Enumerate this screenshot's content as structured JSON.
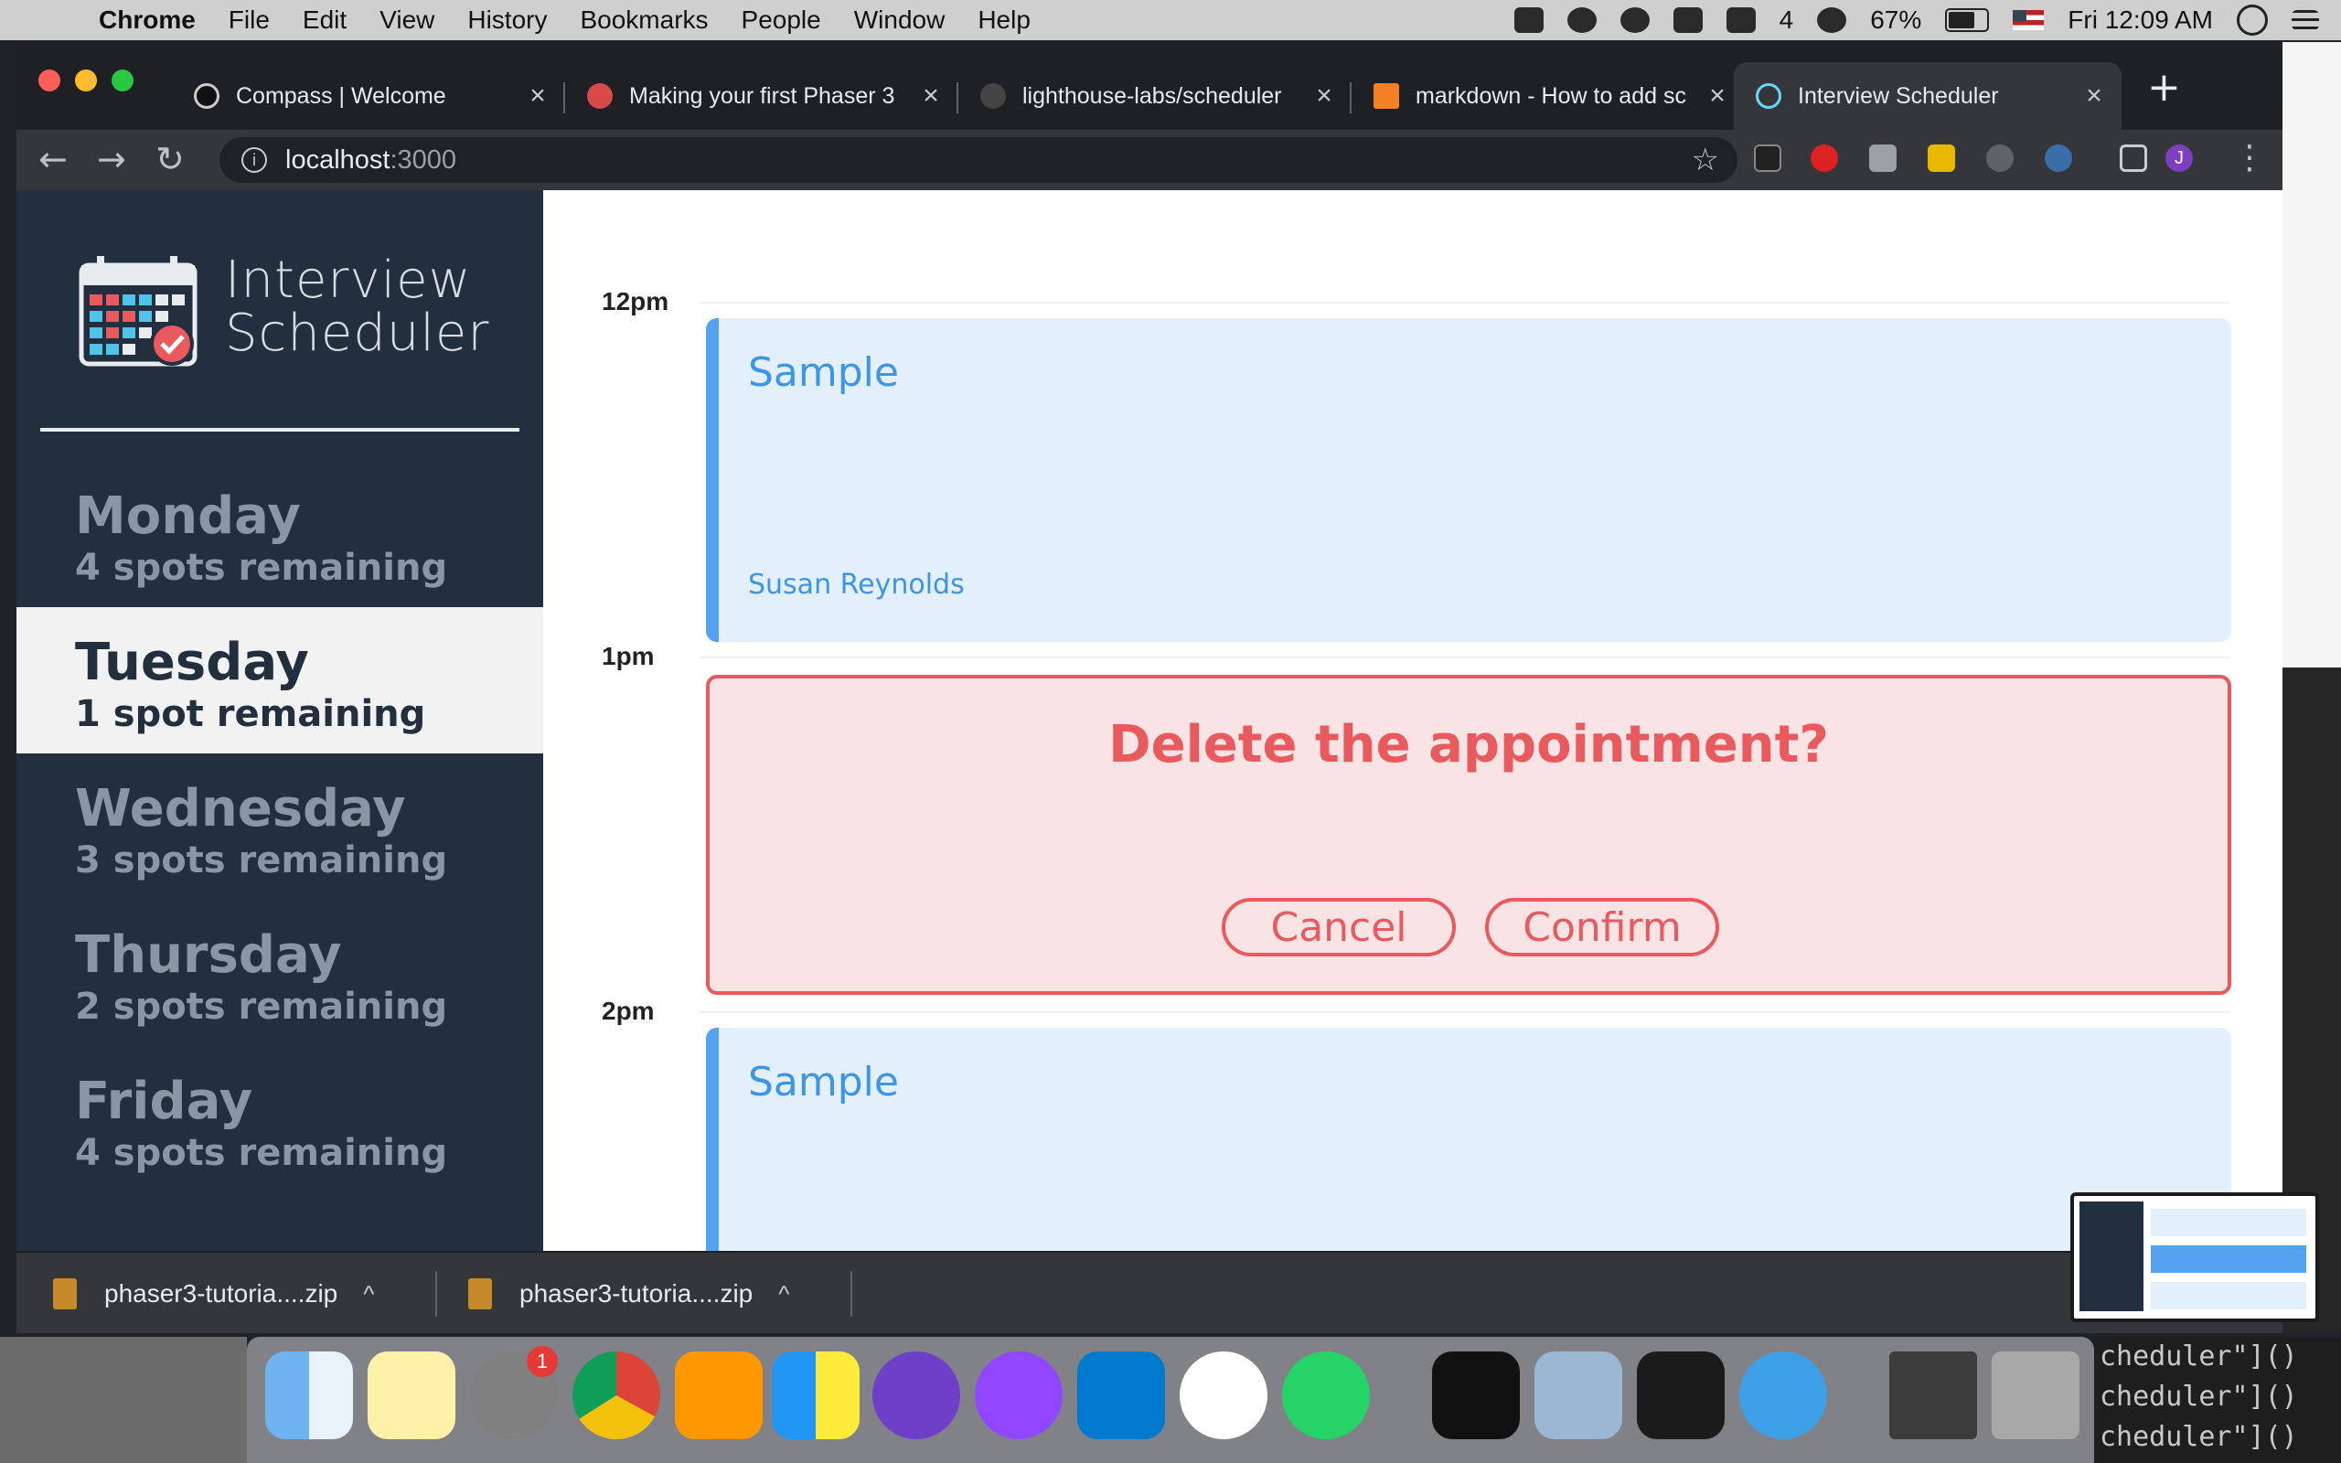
{
  "menubar": {
    "apple_glyph": "",
    "app_name": "Chrome",
    "menus": [
      "File",
      "Edit",
      "View",
      "History",
      "Bookmarks",
      "People",
      "Window",
      "Help"
    ],
    "status": {
      "notification_count": "4",
      "battery_percent": "67%",
      "clock": "Fri 12:09 AM"
    }
  },
  "browser": {
    "tabs": [
      {
        "title": "Compass | Welcome",
        "icon": "compass-icon",
        "close": "×"
      },
      {
        "title": "Making your first Phaser 3",
        "icon": "phaser-icon",
        "close": "×"
      },
      {
        "title": "lighthouse-labs/scheduler",
        "icon": "github-icon",
        "close": "×"
      },
      {
        "title": "markdown - How to add sc",
        "icon": "stackoverflow-icon",
        "close": "×"
      },
      {
        "title": "Interview Scheduler",
        "icon": "react-icon",
        "close": "×",
        "active": true
      }
    ],
    "new_tab": "+",
    "back": "←",
    "forward": "→",
    "reload": "↻",
    "info_glyph": "i",
    "url_host": "localhost",
    "url_port": ":3000",
    "bookmark_star": "☆",
    "profile_initial": "J",
    "menu_dots": "⋮"
  },
  "app": {
    "logo_line1": "Interview",
    "logo_line2": "Scheduler",
    "days": [
      {
        "name": "Monday",
        "spots": "4 spots remaining",
        "selected": false
      },
      {
        "name": "Tuesday",
        "spots": "1 spot remaining",
        "selected": true
      },
      {
        "name": "Wednesday",
        "spots": "3 spots remaining",
        "selected": false
      },
      {
        "name": "Thursday",
        "spots": "2 spots remaining",
        "selected": false
      },
      {
        "name": "Friday",
        "spots": "4 spots remaining",
        "selected": false
      }
    ],
    "times": [
      "12pm",
      "1pm",
      "2pm"
    ],
    "appointments": [
      {
        "student": "Sample",
        "interviewer": "Susan Reynolds"
      },
      {
        "student": "Sample",
        "interviewer": ""
      }
    ],
    "confirm": {
      "message": "Delete the appointment?",
      "cancel": "Cancel",
      "confirm": "Confirm"
    }
  },
  "downloads": [
    {
      "name": "phaser3-tutoria....zip",
      "caret": "^"
    },
    {
      "name": "phaser3-tutoria....zip",
      "caret": "^"
    }
  ],
  "background": {
    "code_lines": [
      "cheduler\"]()",
      "cheduler\"]()",
      "cheduler\"]()"
    ]
  },
  "dock": {
    "badges": {
      "system_preferences": "1"
    },
    "apps": [
      "finder-icon",
      "notes-icon",
      "system-preferences-icon",
      "chrome-icon",
      "sublime-text-icon",
      "tiles-icon",
      "github-desktop-icon",
      "twitch-icon",
      "vscode-icon",
      "slack-icon",
      "whatsapp-icon",
      "terminal-icon",
      "preview-icon",
      "activity-monitor-icon",
      "tableplus-icon",
      "chrome-minimized-icon",
      "trash-icon"
    ]
  },
  "colors": {
    "sidebar": "#222f3e",
    "appointment_accent": "#55a1f2",
    "danger": "#e85a5e"
  }
}
